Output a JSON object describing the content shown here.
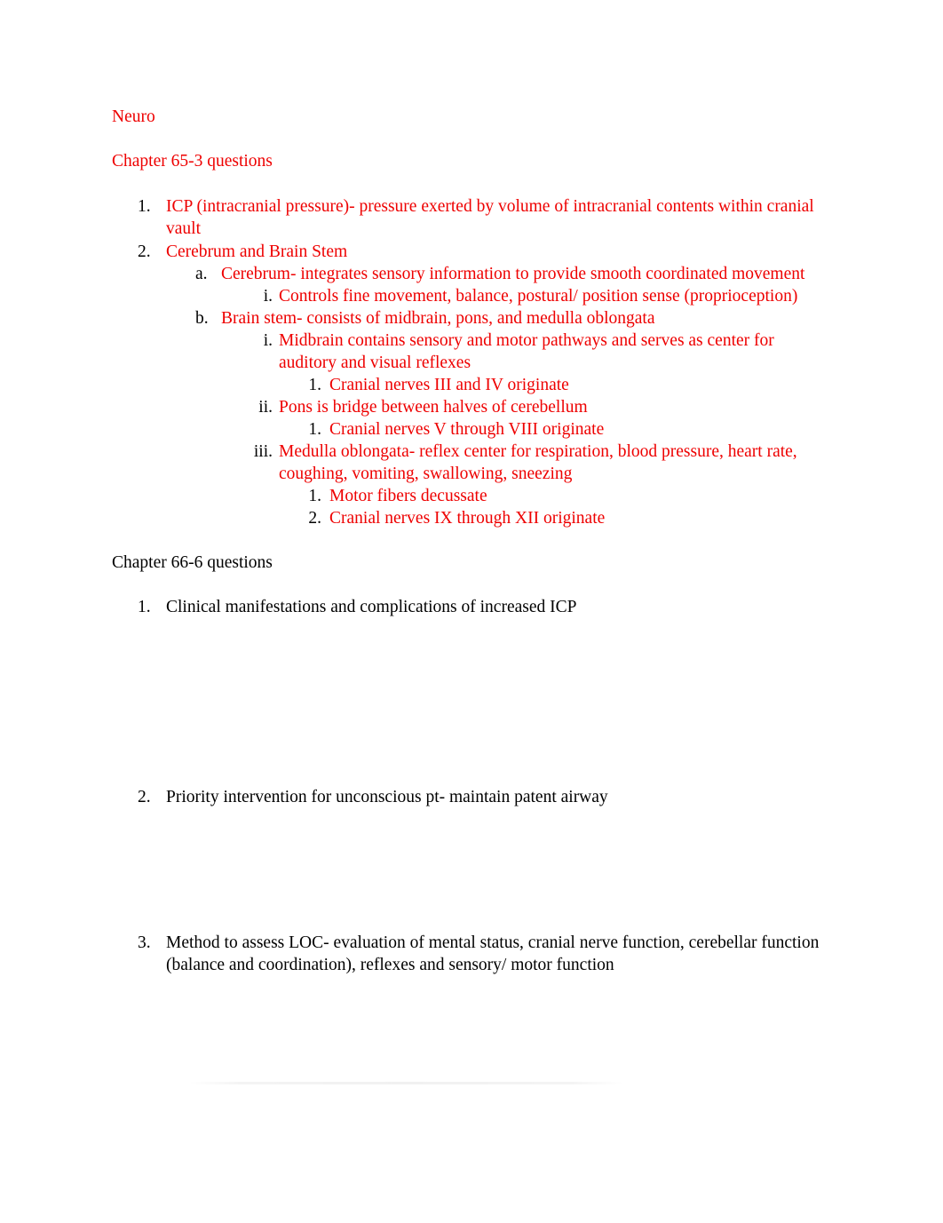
{
  "document": {
    "title": "Neuro",
    "text_colors": {
      "red": "#ee0000",
      "black": "#000000"
    },
    "background": "#ffffff"
  },
  "sections": [
    {
      "heading": "Chapter 65-3 questions",
      "heading_color": "red",
      "items": [
        {
          "marker": "1.",
          "level": 1,
          "color": "red",
          "text": "ICP (intracranial pressure)- pressure exerted by volume of intracranial contents within cranial vault"
        },
        {
          "marker": "2.",
          "level": 1,
          "color": "red",
          "text": "Cerebrum and Brain Stem"
        },
        {
          "marker": "a.",
          "level": 2,
          "color": "red",
          "text": "Cerebrum- integrates sensory information to provide smooth coordinated movement"
        },
        {
          "marker": "i.",
          "level": 3,
          "color": "red",
          "text": "Controls fine movement, balance, postural/ position sense (proprioception)"
        },
        {
          "marker": "b.",
          "level": 2,
          "color": "red",
          "text": "Brain stem- consists of midbrain, pons, and medulla oblongata"
        },
        {
          "marker": "i.",
          "level": 3,
          "color": "red",
          "text": "Midbrain contains sensory and motor pathways and serves as center for auditory and visual reflexes"
        },
        {
          "marker": "1.",
          "level": 4,
          "color": "red",
          "text": "Cranial nerves III and IV originate"
        },
        {
          "marker": "ii.",
          "level": 3,
          "color": "red",
          "text": "Pons is bridge between halves of cerebellum"
        },
        {
          "marker": "1.",
          "level": 4,
          "color": "red",
          "text": "Cranial nerves V through VIII originate"
        },
        {
          "marker": "iii.",
          "level": 3,
          "color": "red",
          "text": "Medulla oblongata- reflex center for respiration, blood pressure, heart rate, coughing, vomiting, swallowing, sneezing"
        },
        {
          "marker": "1.",
          "level": 4,
          "color": "red",
          "text": "Motor fibers decussate"
        },
        {
          "marker": "2.",
          "level": 4,
          "color": "red",
          "text": "Cranial nerves IX through XII originate"
        }
      ]
    },
    {
      "heading": "Chapter 66-6 questions",
      "heading_color": "black",
      "items": [
        {
          "marker": "1.",
          "level": 1,
          "color": "black",
          "text": "Clinical manifestations and complications of increased ICP"
        },
        {
          "marker": "2.",
          "level": 1,
          "color": "black",
          "text": "Priority intervention for unconscious pt- maintain patent airway"
        },
        {
          "marker": "3.",
          "level": 1,
          "color": "black",
          "text": "Method to assess LOC- evaluation of mental status, cranial nerve function, cerebellar function (balance and coordination), reflexes and sensory/ motor function"
        }
      ]
    }
  ]
}
